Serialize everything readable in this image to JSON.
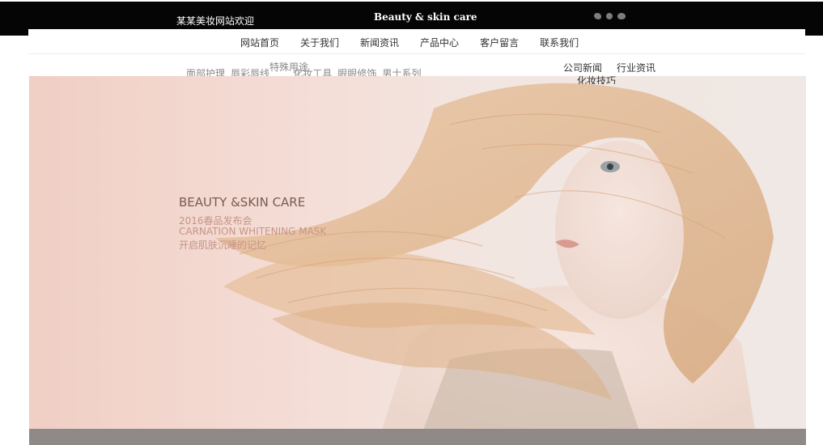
{
  "header": {
    "welcome": "某某美妆网站欢迎您。",
    "brand": "Beauty & skin care",
    "social_icons": [
      "weibo-icon",
      "qq-icon",
      "wechat-icon"
    ]
  },
  "nav": {
    "items": [
      "网站首页",
      "关于我们",
      "新闻资讯",
      "产品中心",
      "客户留言",
      "联系我们"
    ]
  },
  "product_submenu": {
    "special": "特殊用途",
    "items": [
      "面部护理",
      "唇彩唇线",
      "化妆工具",
      "眼眼修饰",
      "男士系列"
    ]
  },
  "news_submenu": {
    "items": [
      "公司新闻",
      "行业资讯",
      "化妆技巧"
    ]
  },
  "hero": {
    "heading": "BEAUTY &SKIN CARE",
    "line1": "2016春品发布会",
    "line2": "CARNATION WHITENING MASK",
    "line3": "开启肌肤沉睡的记忆"
  },
  "colors": {
    "topbar": "#050505",
    "hero_bg": "#f0cfc4",
    "hero_text": "#c79486",
    "hero_heading": "#7a5b52"
  }
}
